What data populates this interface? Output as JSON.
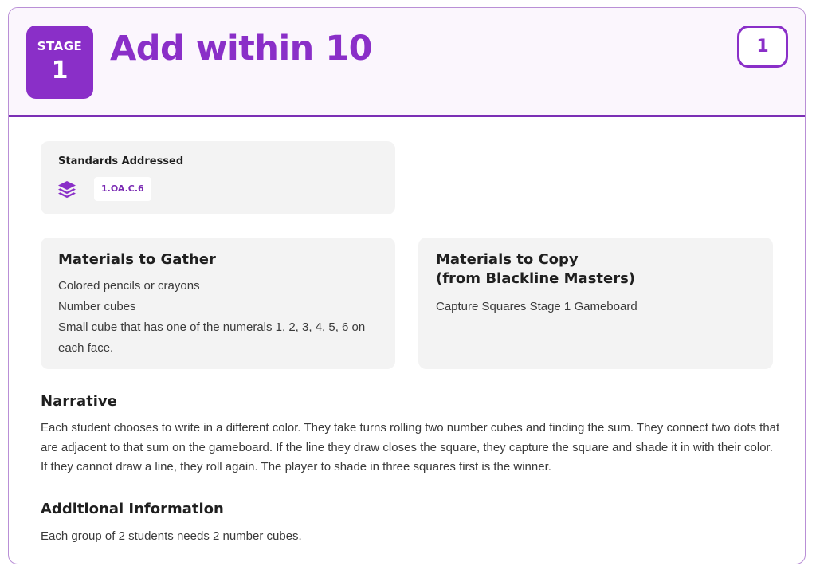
{
  "header": {
    "stage_label": "STAGE",
    "stage_number": "1",
    "title": "Add within 10",
    "lesson_number": "1"
  },
  "standards": {
    "title": "Standards Addressed",
    "icon": "layers-icon",
    "tags": [
      "1.OA.C.6"
    ]
  },
  "materials_gather": {
    "title": "Materials to Gather",
    "items": [
      "Colored pencils or crayons",
      "Number cubes",
      "Small cube that has one of the numerals 1, 2, 3, 4, 5, 6 on each face."
    ]
  },
  "materials_copy": {
    "title_line1": "Materials to Copy",
    "title_line2": "(from Blackline Masters)",
    "items": [
      "Capture Squares Stage 1 Gameboard"
    ]
  },
  "narrative": {
    "title": "Narrative",
    "text": "Each student chooses to write in a different color. They take turns rolling two number cubes and finding the sum. They connect two dots that are adjacent to that sum on the gameboard. If the line they draw closes the square, they capture the square and shade it in with their color. If they cannot draw a line, they roll again. The player to shade in three squares first is the winner."
  },
  "additional_info": {
    "title": "Additional Information",
    "text": "Each group of 2 students needs 2 number cubes."
  },
  "colors": {
    "accent": "#8a2fc8",
    "header_bg": "#fbf6fd",
    "panel_bg": "#f3f3f3"
  }
}
